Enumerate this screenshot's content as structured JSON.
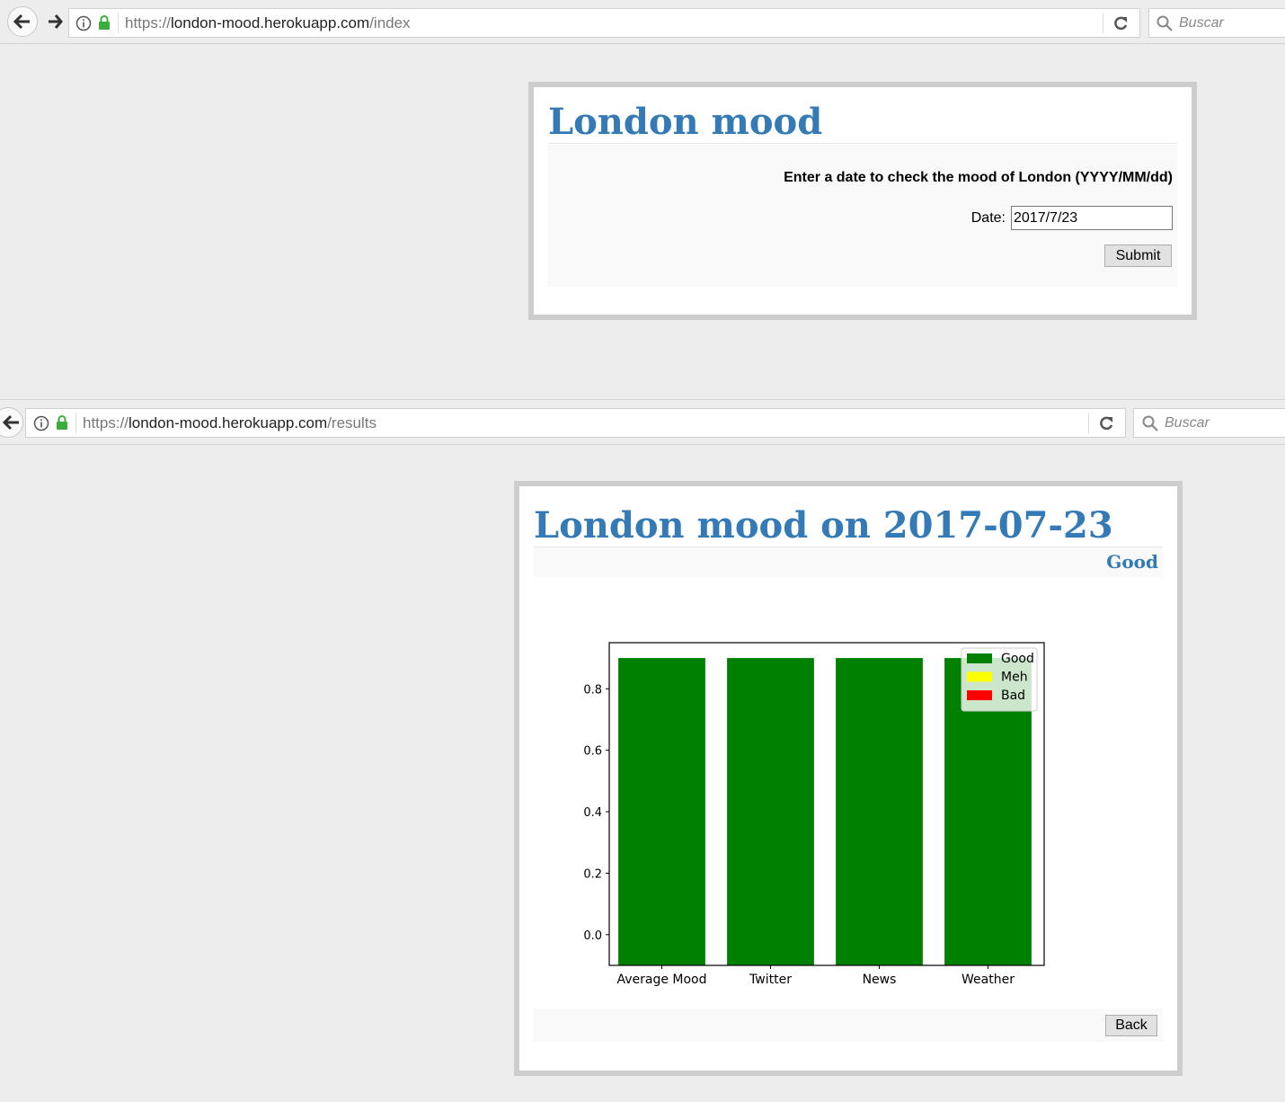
{
  "window1": {
    "url": {
      "scheme": "https://",
      "host": "london-mood.herokuapp.com",
      "path": "/index"
    },
    "search_placeholder": "Buscar",
    "page": {
      "title": "London mood",
      "form_heading": "Enter a date to check the mood of London (YYYY/MM/dd)",
      "date_label": "Date:",
      "date_value": "2017/7/23",
      "submit_label": "Submit"
    }
  },
  "window2": {
    "url": {
      "scheme": "https://",
      "host": "london-mood.herokuapp.com",
      "path": "/results"
    },
    "search_placeholder": "Buscar",
    "page": {
      "title": "London mood on 2017-07-23",
      "mood_result": "Good",
      "back_label": "Back"
    }
  },
  "chart_data": {
    "type": "bar",
    "categories": [
      "Average Mood",
      "Twitter",
      "News",
      "Weather"
    ],
    "values": [
      0.9,
      0.9,
      0.9,
      0.9
    ],
    "bar_colors": [
      "#008000",
      "#008000",
      "#008000",
      "#008000"
    ],
    "ylim": [
      -0.1,
      0.95
    ],
    "yticks": [
      0.0,
      0.2,
      0.4,
      0.6,
      0.8
    ],
    "legend": {
      "position": "upper right",
      "entries": [
        {
          "label": "Good",
          "color": "#008000"
        },
        {
          "label": "Meh",
          "color": "#ffff00"
        },
        {
          "label": "Bad",
          "color": "#ff0000"
        }
      ]
    },
    "grid": false
  }
}
